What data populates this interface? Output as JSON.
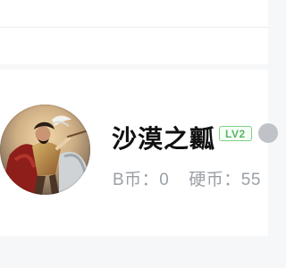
{
  "profile": {
    "username": "沙漠之瓤",
    "level_badge": "LV2",
    "b_coin_label": "B币：",
    "b_coin_value": "0",
    "hard_coin_label": "硬币：",
    "hard_coin_value": "55"
  }
}
